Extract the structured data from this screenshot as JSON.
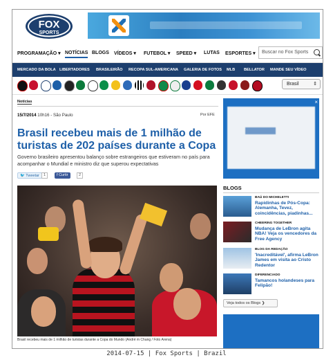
{
  "nav": {
    "items": [
      "PROGRAMAÇÃO ▾",
      "NOTÍCIAS",
      "BLOGS",
      "VÍDEOS ▾",
      "FUTEBOL ▾",
      "SPEED ▾",
      "LUTAS",
      "ESPORTES ▾"
    ],
    "search_placeholder": "Buscar no Fox Sports"
  },
  "subnav": {
    "items": [
      "MERCADO DA BOLA",
      "LIBERTADORES",
      "BRASILEIRÃO",
      "RECOPA SUL-AMERICANA",
      "GALERIA DE FOTOS",
      "MLB",
      "BELLATOR",
      "MANDE SEU VÍDEO"
    ]
  },
  "region_select": "Brasil",
  "article": {
    "section_tag": "Notícias",
    "date": "15/7/2014",
    "time_place": "10h16 - São Paulo",
    "credit": "Por EFE",
    "headline": "Brasil recebeu mais de 1 milhão de turistas de 202 países durante a Copa",
    "lead": "Governo brasileiro apresentou balanço sobre estrangeiros que estiveram no país para acompanhar o Mundial e ministro diz que superou expectativas",
    "tweet_label": "Tweetar",
    "tweet_count": "1",
    "fb_label": "Curtir",
    "fb_count": "2",
    "caption": "Brasil recebeu mais de 1 milhão de turistas durante a Copa do Mundo (André m Chang / Foto Arena)"
  },
  "sidebar": {
    "blogs_heading": "BLOGS",
    "blogs": [
      {
        "title": "BAÚ DO MICHELETTI",
        "text": "Rapidinhas de Pós-Copa: Alemanha, Tevez, coincidências, piadinhas..."
      },
      {
        "title": "CHEERING TOGETHER",
        "text": "Mudança de LeBron agita NBA! Veja os vencedores da Free Agency"
      },
      {
        "title": "BLOG DA REDAÇÃO",
        "text": "'Inacreditável', afirma LeBron James em visita ao Cristo Redentor"
      },
      {
        "title": "DIFERENCIADO",
        "text": "Tamancos holandeses para Felipão!"
      }
    ],
    "see_all": "Veja todos os Blogs ❯"
  },
  "footer": "2014-07-15 | Fox Sports | Brazil",
  "colors": {
    "brand_blue": "#1d5fa8",
    "subnav_bg": "#1d3f6e"
  }
}
